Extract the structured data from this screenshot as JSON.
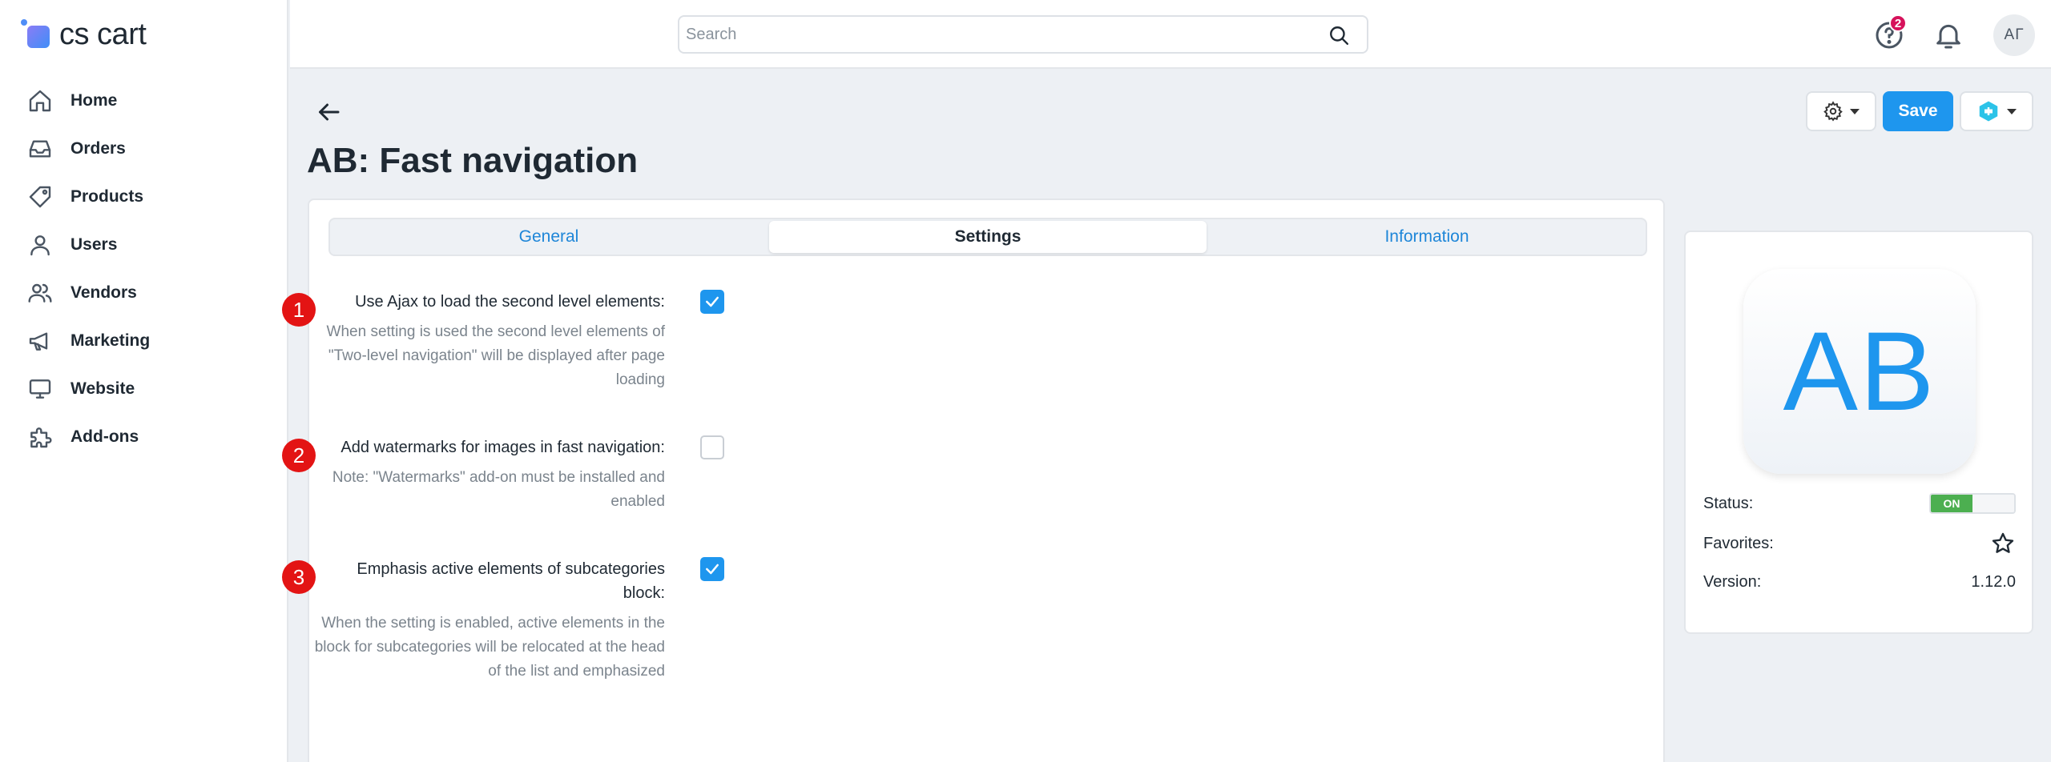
{
  "app": {
    "logo_text": "cs cart"
  },
  "sidebar": {
    "items": [
      {
        "label": "Home",
        "icon": "home-icon"
      },
      {
        "label": "Orders",
        "icon": "inbox-icon"
      },
      {
        "label": "Products",
        "icon": "tag-icon"
      },
      {
        "label": "Users",
        "icon": "user-icon"
      },
      {
        "label": "Vendors",
        "icon": "users-icon"
      },
      {
        "label": "Marketing",
        "icon": "megaphone-icon"
      },
      {
        "label": "Website",
        "icon": "monitor-icon"
      },
      {
        "label": "Add-ons",
        "icon": "puzzle-icon"
      }
    ]
  },
  "topbar": {
    "search_placeholder": "Search",
    "help_badge": "2",
    "avatar_initials": "АГ"
  },
  "header": {
    "title": "AB: Fast navigation",
    "save_label": "Save"
  },
  "tabs": [
    {
      "label": "General",
      "active": false
    },
    {
      "label": "Settings",
      "active": true
    },
    {
      "label": "Information",
      "active": false
    }
  ],
  "settings": [
    {
      "marker": "1",
      "label": "Use Ajax to load the second level elements:",
      "description": "When setting is used the second level elements of \"Two-level navigation\" will be displayed after page loading",
      "checked": true
    },
    {
      "marker": "2",
      "label": "Add watermarks for images in fast navigation:",
      "description": "Note: \"Watermarks\" add-on must be installed and enabled",
      "checked": false
    },
    {
      "marker": "3",
      "label": "Emphasis active elements of subcategories block:",
      "description": "When the setting is enabled, active elements in the block for subcategories will be relocated at the head of the list and emphasized",
      "checked": true
    }
  ],
  "addon_info": {
    "logo_text": "AB",
    "status_label": "Status:",
    "status_value": "ON",
    "favorites_label": "Favorites:",
    "version_label": "Version:",
    "version_value": "1.12.0"
  },
  "colors": {
    "accent": "#1e96ee",
    "marker_red": "#e31414",
    "status_on": "#4caf50",
    "badge": "#d6125b"
  }
}
